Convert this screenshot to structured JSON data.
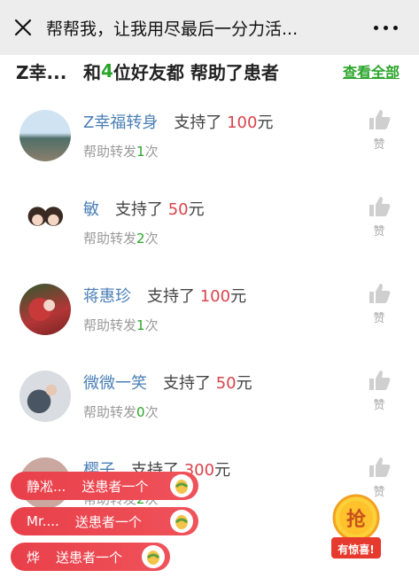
{
  "navbar": {
    "title": "帮帮我，让我用尽最后一分力活...",
    "close_icon": "close-icon",
    "more_icon": "more-dots-icon"
  },
  "summary": {
    "first_name": "Z幸...",
    "and": "和",
    "count": "4",
    "rest": "位好友都 帮助了患者",
    "see_all": "查看全部"
  },
  "supporters": [
    {
      "name": "Z幸福转身",
      "support": "支持了",
      "amount": "100",
      "unit": "元",
      "share_prefix": "帮助转发",
      "share_times": "1",
      "share_suffix": "次",
      "like_label": "赞"
    },
    {
      "name": "敏",
      "support": "支持了",
      "amount": "50",
      "unit": "元",
      "share_prefix": "帮助转发",
      "share_times": "2",
      "share_suffix": "次",
      "like_label": "赞"
    },
    {
      "name": "蒋惠珍",
      "support": "支持了",
      "amount": "100",
      "unit": "元",
      "share_prefix": "帮助转发",
      "share_times": "1",
      "share_suffix": "次",
      "like_label": "赞"
    },
    {
      "name": "微微一笑",
      "support": "支持了",
      "amount": "50",
      "unit": "元",
      "share_prefix": "帮助转发",
      "share_times": "0",
      "share_suffix": "次",
      "like_label": "赞"
    },
    {
      "name": "樱子",
      "support": "支持了",
      "amount": "300",
      "unit": "元",
      "share_prefix": "帮助转发",
      "share_times": "2",
      "share_suffix": "次",
      "like_label": "赞"
    }
  ],
  "toasts": [
    {
      "name": "静凇...",
      "text": "送患者一个"
    },
    {
      "name": "Mr....",
      "text": "送患者一个"
    },
    {
      "name": "烨",
      "text": "送患者一个"
    }
  ],
  "grab_button": {
    "char": "抢",
    "label": "有惊喜!"
  },
  "colors": {
    "accent_green": "#2aa52a",
    "amount_red": "#d9434b",
    "name_blue": "#4b7fb6",
    "toast_red": "#e8404a"
  }
}
